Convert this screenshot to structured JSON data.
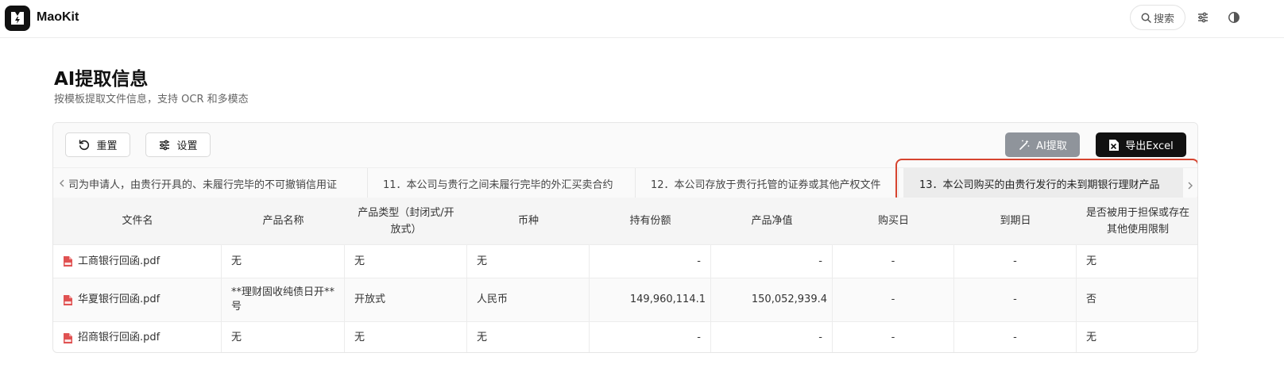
{
  "app": {
    "brand": "MaoKit",
    "search_label": "搜索"
  },
  "header": {
    "title": "AI提取信息",
    "subtitle": "按模板提取文件信息，支持 OCR 和多模态"
  },
  "toolbar": {
    "reset_label": "重置",
    "settings_label": "设置",
    "ai_label": "AI提取",
    "export_label": "导出Excel"
  },
  "tabs": [
    {
      "label": "司为申请人，由贵行开具的、未履行完毕的不可撤销信用证"
    },
    {
      "label": "11．本公司与贵行之间未履行完毕的外汇买卖合约"
    },
    {
      "label": "12．本公司存放于贵行托管的证券或其他产权文件"
    },
    {
      "label": "13．本公司购买的由贵行发行的未到期银行理财产品"
    }
  ],
  "table": {
    "headers": [
      "文件名",
      "产品名称",
      "产品类型（封闭式/开放式）",
      "币种",
      "持有份额",
      "产品净值",
      "购买日",
      "到期日",
      "是否被用于担保或存在其他使用限制"
    ],
    "rows": [
      [
        "工商银行回函.pdf",
        "无",
        "无",
        "无",
        "-",
        "-",
        "-",
        "-",
        "无"
      ],
      [
        "华夏银行回函.pdf",
        "**理财固收纯债日开**号",
        "开放式",
        "人民币",
        "149,960,114.1",
        "150,052,939.4",
        "-",
        "-",
        "否"
      ],
      [
        "招商银行回函.pdf",
        "无",
        "无",
        "无",
        "-",
        "-",
        "-",
        "-",
        "无"
      ]
    ]
  },
  "colors": {
    "accent_red": "#d6442f",
    "pdf_red": "#e05252",
    "dark_button": "#111111",
    "ai_button": "#8f949b"
  }
}
